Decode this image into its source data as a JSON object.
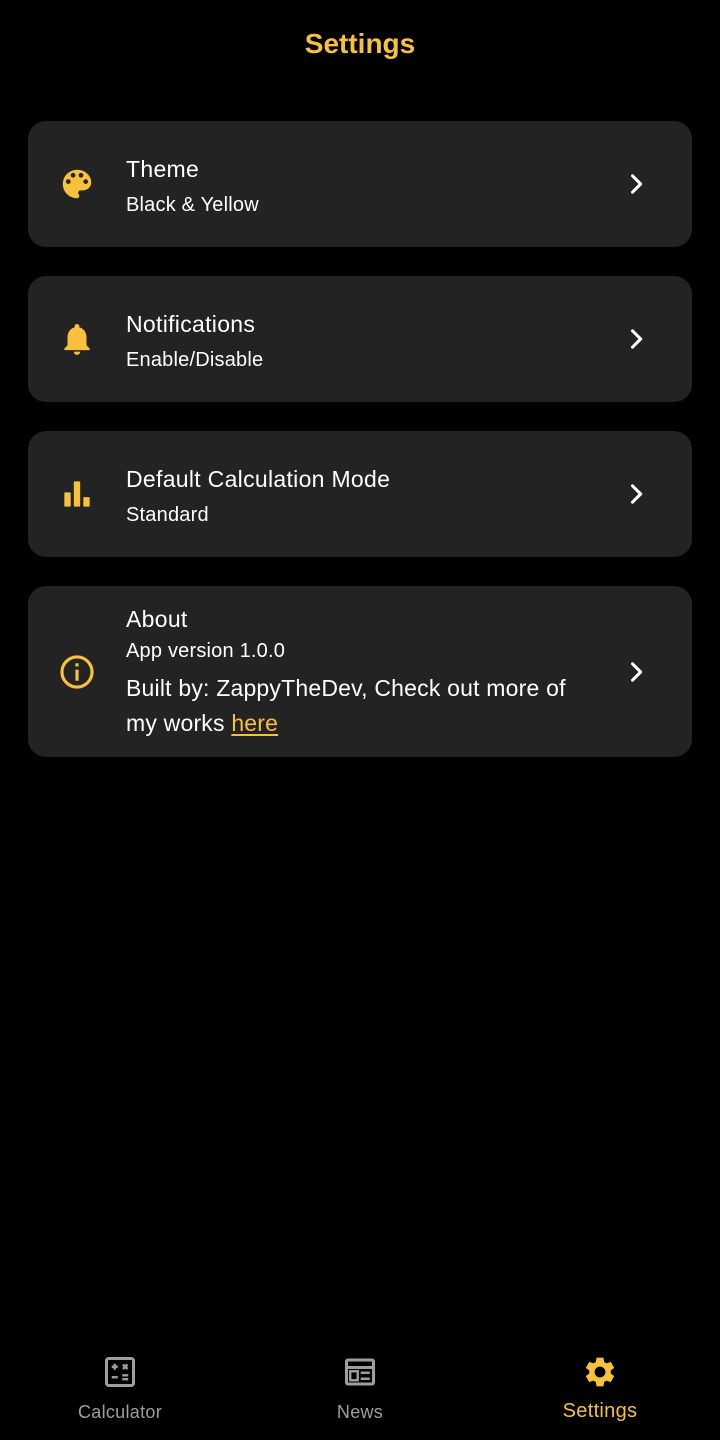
{
  "header": {
    "title": "Settings"
  },
  "colors": {
    "accent": "#f7c13b",
    "background": "#000000",
    "card": "#232323",
    "nav_inactive": "#9e9e9e"
  },
  "settings": {
    "theme": {
      "icon": "palette-icon",
      "title": "Theme",
      "subtitle": "Black & Yellow"
    },
    "notifications": {
      "icon": "bell-icon",
      "title": "Notifications",
      "subtitle": "Enable/Disable"
    },
    "calc_mode": {
      "icon": "bar-chart-icon",
      "title": "Default Calculation Mode",
      "subtitle": "Standard"
    },
    "about": {
      "icon": "info-icon",
      "title": "About",
      "version": "App version 1.0.0",
      "built_by": "Built by: ZappyTheDev, Check out more of my works ",
      "link_text": "here"
    }
  },
  "nav": {
    "items": [
      {
        "label": "Calculator",
        "icon": "calculator-icon",
        "active": false
      },
      {
        "label": "News",
        "icon": "news-icon",
        "active": false
      },
      {
        "label": "Settings",
        "icon": "gear-icon",
        "active": true
      }
    ]
  }
}
